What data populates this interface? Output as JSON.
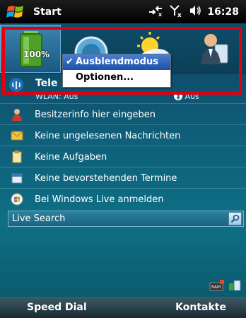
{
  "titlebar": {
    "title": "Start",
    "clock": "16:28",
    "icons": [
      "windows-flag-icon",
      "connectivity-icon",
      "signal-off-icon",
      "volume-icon"
    ]
  },
  "plugins": {
    "battery_percent": "100%",
    "items": [
      "battery-icon",
      "wifi-globe-icon",
      "weather-icon",
      "contact-card-icon"
    ]
  },
  "popup_menu": {
    "items": [
      {
        "label": "Ausblendmodus",
        "checked": true
      },
      {
        "label": "Optionen..."
      }
    ]
  },
  "phone_row": {
    "label": "Tele",
    "wlan": "WLAN: Aus",
    "bluetooth": "Aus"
  },
  "list": [
    {
      "icon": "user-icon",
      "text": "Besitzerinfo hier eingeben"
    },
    {
      "icon": "envelope-icon",
      "text": "Keine ungelesenen Nachrichten"
    },
    {
      "icon": "clipboard-icon",
      "text": "Keine Aufgaben"
    },
    {
      "icon": "calendar-icon",
      "text": "Keine bevorstehenden Termine"
    },
    {
      "icon": "windows-live-icon",
      "text": "Bei Windows Live anmelden"
    }
  ],
  "search": {
    "placeholder": "Live Search"
  },
  "softkeys": {
    "left": "Speed Dial",
    "right": "Kontakte"
  },
  "colors": {
    "highlight": "#e00010",
    "menu_active": "#1e4fa8"
  }
}
